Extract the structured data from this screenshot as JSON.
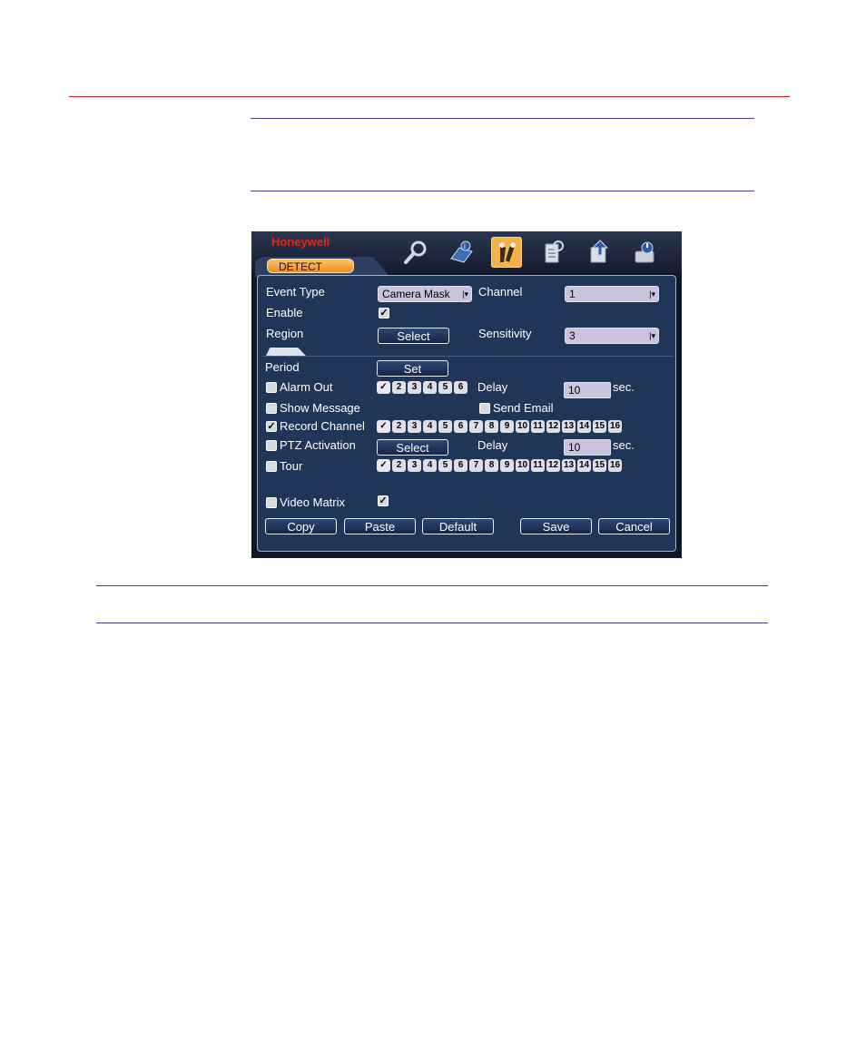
{
  "app": {
    "logo": "Honeywell",
    "tab": "DETECT"
  },
  "toolbar": {
    "icons": [
      "search-icon",
      "info-icon",
      "settings-icon",
      "advanced-icon",
      "backup-icon",
      "shutdown-icon"
    ],
    "active_index": 2
  },
  "form": {
    "event_type": {
      "label": "Event Type",
      "value": "Camera Mask"
    },
    "channel": {
      "label": "Channel",
      "value": "1"
    },
    "enable": {
      "label": "Enable",
      "checked": true
    },
    "region": {
      "label": "Region",
      "button": "Select"
    },
    "sensitivity": {
      "label": "Sensitivity",
      "value": "3"
    },
    "period": {
      "label": "Period",
      "button": "Set"
    },
    "alarm_out": {
      "label": "Alarm Out",
      "checked": false,
      "channels": [
        "1",
        "2",
        "3",
        "4",
        "5",
        "6"
      ],
      "selected": [
        "1"
      ]
    },
    "delay1": {
      "label": "Delay",
      "value": "10",
      "unit": "sec."
    },
    "show_message": {
      "label": "Show Message",
      "checked": false
    },
    "send_email": {
      "label": "Send Email",
      "checked": false
    },
    "record_channel": {
      "label": "Record Channel",
      "checked": true,
      "channels": [
        "1",
        "2",
        "3",
        "4",
        "5",
        "6",
        "7",
        "8",
        "9",
        "10",
        "11",
        "12",
        "13",
        "14",
        "15",
        "16"
      ],
      "selected": [
        "1"
      ]
    },
    "ptz_activation": {
      "label": "PTZ Activation",
      "checked": false,
      "button": "Select"
    },
    "delay2": {
      "label": "Delay",
      "value": "10",
      "unit": "sec."
    },
    "tour": {
      "label": "Tour",
      "checked": false,
      "channels": [
        "1",
        "2",
        "3",
        "4",
        "5",
        "6",
        "7",
        "8",
        "9",
        "10",
        "11",
        "12",
        "13",
        "14",
        "15",
        "16"
      ],
      "selected": [
        "1"
      ]
    },
    "video_matrix": {
      "label": "Video Matrix",
      "checked": false,
      "value_checked": true
    }
  },
  "buttons": {
    "copy": "Copy",
    "paste": "Paste",
    "default": "Default",
    "save": "Save",
    "cancel": "Cancel"
  },
  "colors": {
    "accent": "#f3b34a",
    "panel": "#1f3658",
    "logo": "#e2261a",
    "rule_red": "#c0201e",
    "rule_blue": "#3a3aa8"
  }
}
